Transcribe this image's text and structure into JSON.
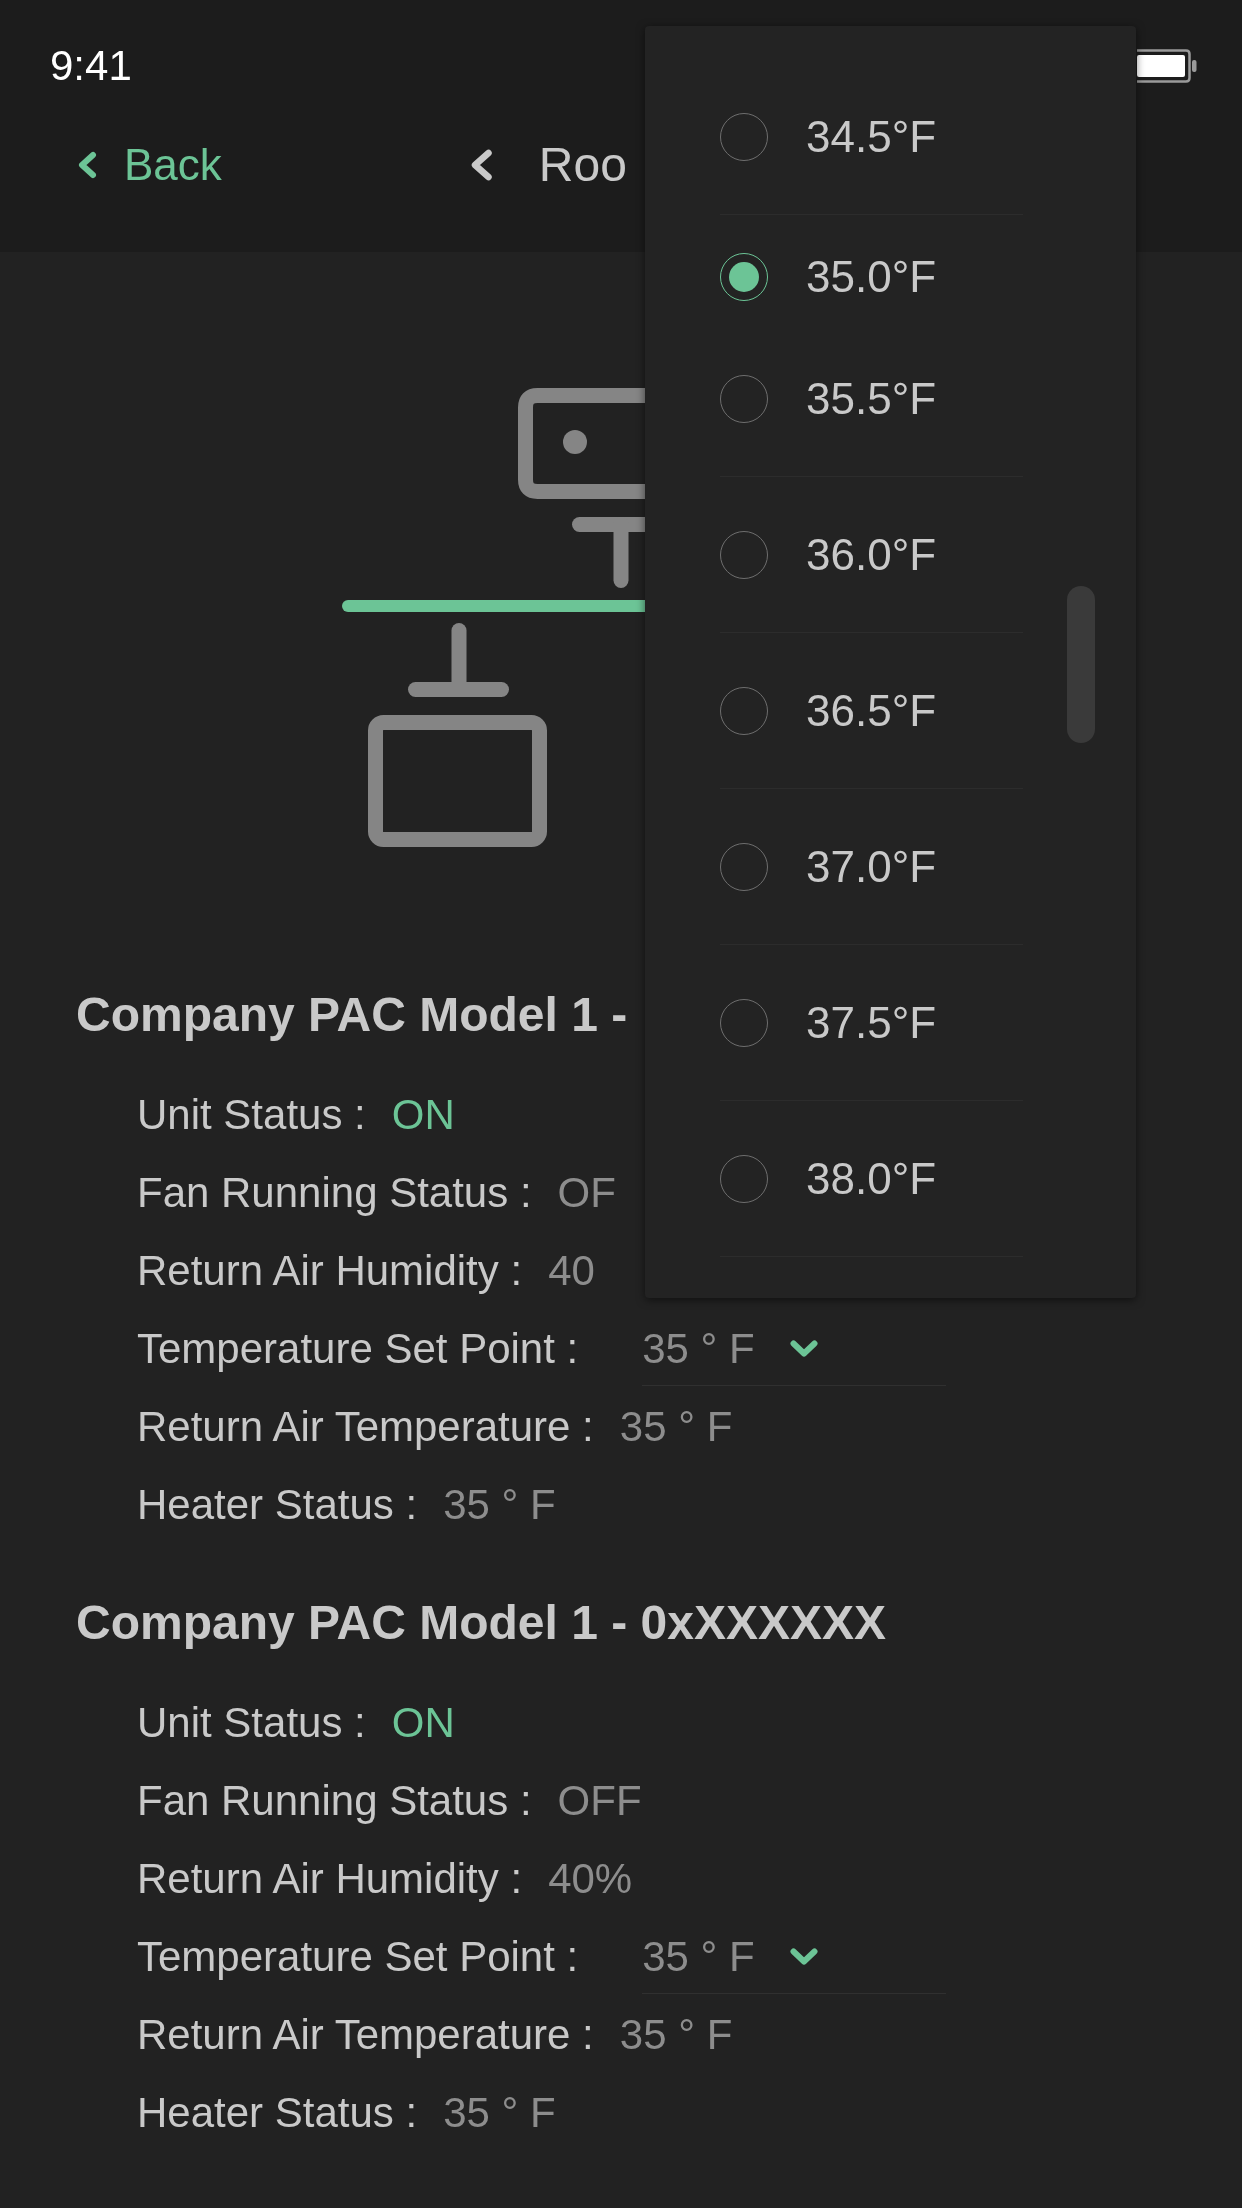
{
  "status_bar": {
    "time": "9:41"
  },
  "nav_bar": {
    "back": "Back",
    "title": "Roo"
  },
  "setpoint_menu": {
    "options": [
      {
        "label": "34.5°F",
        "selected": false
      },
      {
        "label": "35.0°F",
        "selected": true
      },
      {
        "label": "35.5°F",
        "selected": false
      },
      {
        "label": "36.0°F",
        "selected": false
      },
      {
        "label": "36.5°F",
        "selected": false
      },
      {
        "label": "37.0°F",
        "selected": false
      },
      {
        "label": "37.5°F",
        "selected": false
      },
      {
        "label": "38.0°F",
        "selected": false
      }
    ]
  },
  "units": [
    {
      "title": "Company PAC Model 1 -",
      "rows": [
        {
          "kind": "status",
          "label": "Unit Status :",
          "value": "ON",
          "on": true
        },
        {
          "kind": "status",
          "label": "Fan Running Status :",
          "value": "OF",
          "on": false
        },
        {
          "kind": "text",
          "label": "Return Air Humidity :",
          "value": "40"
        },
        {
          "kind": "select",
          "label": "Temperature Set Point :",
          "value": "35 ° F"
        },
        {
          "kind": "text",
          "label": "Return Air Temperature :",
          "value": "35 ° F"
        },
        {
          "kind": "text",
          "label": "Heater Status :",
          "value": "35 ° F"
        }
      ]
    },
    {
      "title": "Company PAC Model 1 - 0xXXXXXX",
      "rows": [
        {
          "kind": "status",
          "label": "Unit Status :",
          "value": "ON",
          "on": true
        },
        {
          "kind": "status",
          "label": "Fan Running Status :",
          "value": "OFF",
          "on": false
        },
        {
          "kind": "text",
          "label": "Return Air Humidity :",
          "value": "40%"
        },
        {
          "kind": "select",
          "label": "Temperature Set Point :",
          "value": "35 ° F"
        },
        {
          "kind": "text",
          "label": "Return Air Temperature :",
          "value": "35 ° F"
        },
        {
          "kind": "text",
          "label": "Heater Status :",
          "value": "35 ° F"
        }
      ]
    }
  ]
}
